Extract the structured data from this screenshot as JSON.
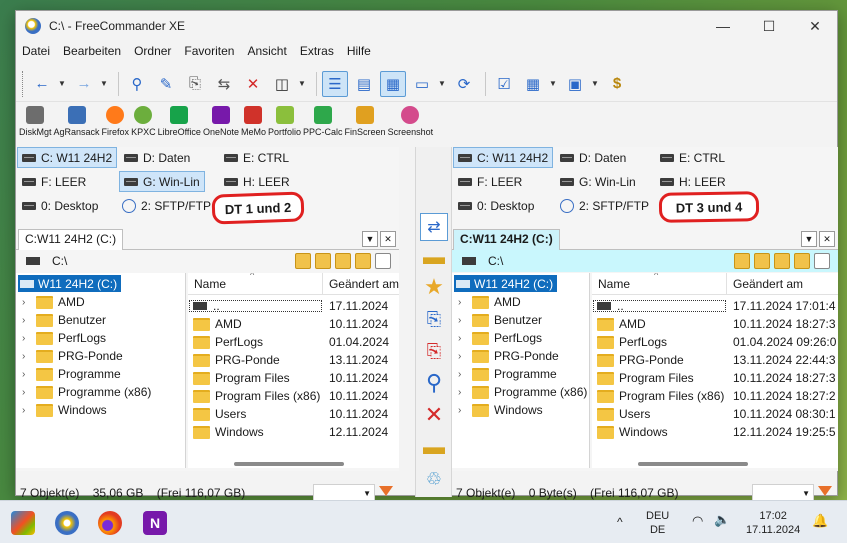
{
  "window": {
    "title": "C:\\ - FreeCommander XE",
    "minimize": "—",
    "maximize": "☐",
    "close": "✕"
  },
  "menu": [
    "Datei",
    "Bearbeiten",
    "Ordner",
    "Favoriten",
    "Ansicht",
    "Extras",
    "Hilfe"
  ],
  "toolbar_icons": [
    "back-arrow-icon",
    "forward-arrow-icon",
    "search-icon",
    "edit-pen-icon",
    "copy-file-icon",
    "move-file-icon",
    "delete-icon",
    "binoculars-icon",
    "panel-layout-icon",
    "view-list-icon",
    "view-details-icon",
    "view-thumbnail-icon",
    "sync-icon",
    "checklist-icon",
    "grid-icon",
    "pc-icon",
    "dollar-folder-icon"
  ],
  "apps": [
    {
      "label": "DiskMgt",
      "color": "#6d6d6d"
    },
    {
      "label": "AgRansack",
      "color": "#3b6fb6"
    },
    {
      "label": "Firefox",
      "color": "#ff7a1a"
    },
    {
      "label": "KPXC",
      "color": "#6cae3d"
    },
    {
      "label": "LibreOffice",
      "color": "#17a34a"
    },
    {
      "label": "OneNote",
      "color": "#7719aa"
    },
    {
      "label": "MeMo",
      "color": "#d0322a"
    },
    {
      "label": "Portfolio",
      "color": "#8bbf3c"
    },
    {
      "label": "PPC-Calc",
      "color": "#2ea84b"
    },
    {
      "label": "FinScreen",
      "color": "#e0a020"
    },
    {
      "label": "Screenshot",
      "color": "#d44b8c"
    }
  ],
  "left": {
    "drives": [
      "C: W11 24H2",
      "D: Daten",
      "E: CTRL",
      "F: LEER",
      "G: Win-Lin",
      "H: LEER",
      "0: Desktop",
      "2: SFTP/FTP"
    ],
    "tab": "C:W11 24H2 (C:)",
    "path": "C:\\",
    "tree_root": "W11 24H2 (C:)",
    "tree": [
      "AMD",
      "Benutzer",
      "PerfLogs",
      "PRG-Ponde",
      "Programme",
      "Programme (x86)",
      "Windows"
    ],
    "col_name": "Name",
    "col_date": "Geändert am",
    "files": [
      {
        "name": "..",
        "date": "17.11.2024"
      },
      {
        "name": "AMD",
        "date": "10.11.2024"
      },
      {
        "name": "PerfLogs",
        "date": "01.04.2024"
      },
      {
        "name": "PRG-Ponde",
        "date": "13.11.2024"
      },
      {
        "name": "Program Files",
        "date": "10.11.2024"
      },
      {
        "name": "Program Files (x86)",
        "date": "10.11.2024"
      },
      {
        "name": "Users",
        "date": "10.11.2024"
      },
      {
        "name": "Windows",
        "date": "12.11.2024"
      }
    ],
    "status": "7 Objekt(e)    35,06 GB    (Frei 116,07 GB)",
    "annotation": "DT 1 und 2"
  },
  "right": {
    "drives": [
      "C: W11 24H2",
      "D: Daten",
      "E: CTRL",
      "F: LEER",
      "G: Win-Lin",
      "H: LEER",
      "0: Desktop",
      "2: SFTP/FTP"
    ],
    "tab": "C:W11 24H2 (C:)",
    "path": "C:\\",
    "tree_root": "W11 24H2 (C:)",
    "tree": [
      "AMD",
      "Benutzer",
      "PerfLogs",
      "PRG-Ponde",
      "Programme",
      "Programme (x86)",
      "Windows"
    ],
    "col_name": "Name",
    "col_date": "Geändert am",
    "files": [
      {
        "name": "..",
        "date": "17.11.2024 17:01:4"
      },
      {
        "name": "AMD",
        "date": "10.11.2024 18:27:3"
      },
      {
        "name": "PerfLogs",
        "date": "01.04.2024 09:26:0"
      },
      {
        "name": "PRG-Ponde",
        "date": "13.11.2024 22:44:3"
      },
      {
        "name": "Program Files",
        "date": "10.11.2024 18:27:3"
      },
      {
        "name": "Program Files (x86)",
        "date": "10.11.2024 18:27:2"
      },
      {
        "name": "Users",
        "date": "10.11.2024 08:30:1"
      },
      {
        "name": "Windows",
        "date": "12.11.2024 19:25:5"
      }
    ],
    "status": "7 Objekt(e)    0 Byte(s)    (Frei 116,07 GB)",
    "annotation": "DT 3 und 4"
  },
  "tray": {
    "lang1": "DEU",
    "lang2": "DE",
    "time": "17:02",
    "date": "17.11.2024",
    "chevron": "^"
  }
}
